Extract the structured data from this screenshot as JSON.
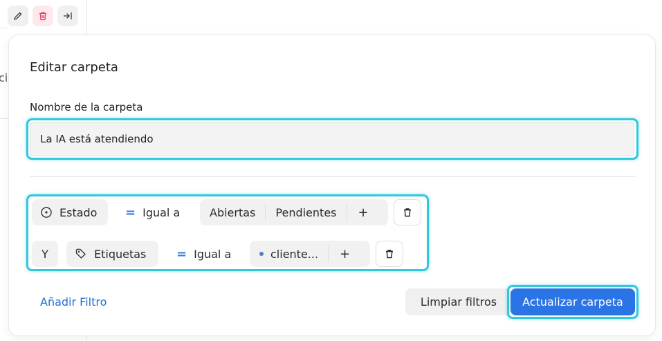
{
  "background": {
    "partial_text": "ci"
  },
  "toolbar": {
    "icons": [
      "edit-icon",
      "trash-icon",
      "collapse-right-icon"
    ],
    "colors": {
      "danger": "#e0455f"
    }
  },
  "modal": {
    "title": "Editar carpeta",
    "name_label": "Nombre de la carpeta",
    "name_value": "La IA está atendiendo",
    "filters": [
      {
        "attribute": "Estado",
        "attribute_icon": "circle-dot-icon",
        "operator": "Igual a",
        "values": [
          "Abiertas",
          "Pendientes"
        ],
        "add": "+"
      },
      {
        "connector": "Y",
        "attribute": "Etiquetas",
        "attribute_icon": "tag-icon",
        "operator": "Igual a",
        "values": [
          "cliente..."
        ],
        "add": "+"
      }
    ],
    "add_filter": "Añadir Filtro",
    "clear_button": "Limpiar filtros",
    "update_button": "Actualizar carpeta"
  },
  "colors": {
    "highlight": "#2ec8e0",
    "primary": "#2a74e6",
    "link": "#1f6fd0",
    "operator": "#2f7be0"
  }
}
